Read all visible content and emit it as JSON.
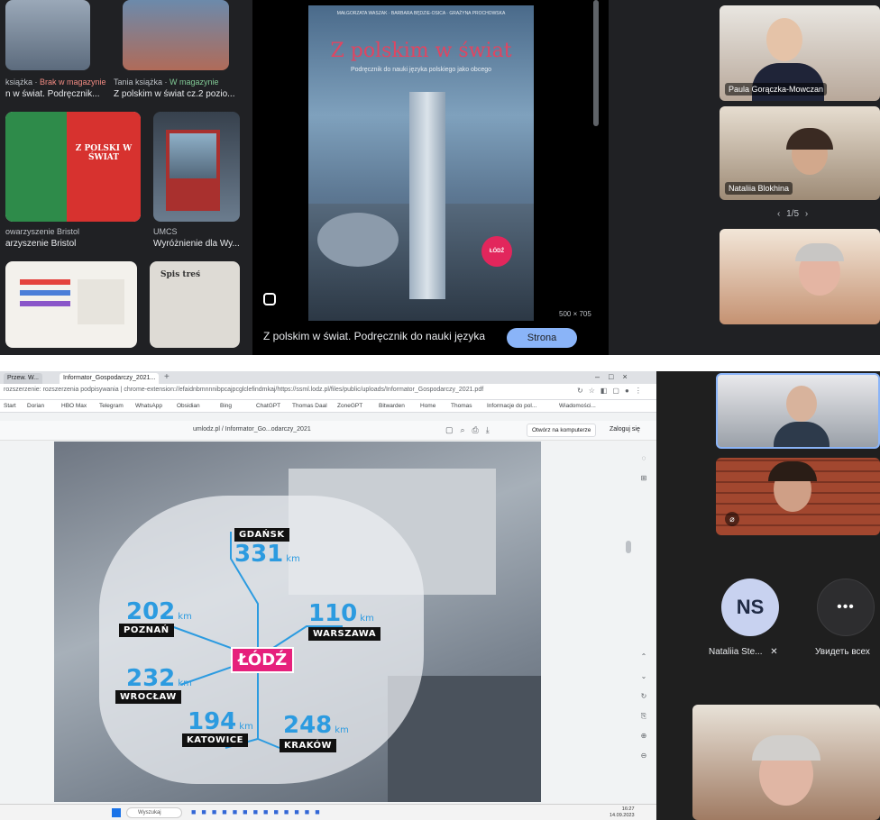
{
  "top": {
    "results": [
      {
        "source_prefix": "książka · ",
        "status": "Brak w magazynie",
        "title": "n w świat. Podręcznik..."
      },
      {
        "source_prefix": "Tania książka · ",
        "status": "W magazynie",
        "title": "Z polskim w świat cz.2 pozio..."
      },
      {
        "source_prefix": "",
        "status": "",
        "title": "arzyszenie Bristol",
        "source_line": "owarzyszenie Bristol"
      },
      {
        "source_prefix": "",
        "status": "",
        "title": "Wyróżnienie dla Wy...",
        "source_line": "UMCS"
      }
    ],
    "book_cover_mini_1": "Z POLSKI W ŚWIAT",
    "spis_label": "Spis treś",
    "viewer": {
      "cover_authors": "MAŁGORZATA WASZAK · BARBARA BĘDZIE-OSICA · GRAŻYNA PROCHOWSKA",
      "cover_title": "Z polskim w świat",
      "cover_subtitle": "Podręcznik do nauki języka polskiego jako obcego",
      "badge": "ŁÓDŹ",
      "size_label": "500 × 705",
      "caption": "Z polskim w świat. Podręcznik do nauki języka",
      "visit_button": "Strona"
    },
    "meeting": {
      "participant_1": "Paula Gorączka-Mowczan",
      "participant_2": "Nataliia Blokhina",
      "pager": "1/5"
    }
  },
  "browser": {
    "tabs": [
      "Przew. W...",
      "Informator_Gospodarczy_2021..."
    ],
    "url": "rozszerzenie: rozszerzenia podpisywania | chrome-extension://efaidnbmnnnibpcajpcglclefindmkaj/https://ssml.lodz.pl/files/public/uploads/Informator_Gospodarczy_2021.pdf",
    "bookmarks": [
      "Start",
      "Dorian",
      "HBO Max",
      "Telegram",
      "WhatsApp",
      "Obsidian",
      "Bing",
      "ChatGPT",
      "Thomas Daal",
      "ZoneGPT",
      "Bitwarden",
      "Home",
      "Thomas",
      "Informacje do pol...",
      "Wiadomości..."
    ],
    "pdf_title": "umlodz.pl / Informator_Go...odarczy_2021",
    "open_button": "Otwórz na komputerze",
    "login": "Zaloguj się",
    "map": {
      "center": "ŁÓDŹ",
      "unit": "km",
      "cities": [
        {
          "name": "GDAŃSK",
          "km": "331"
        },
        {
          "name": "POZNAŃ",
          "km": "202"
        },
        {
          "name": "WARSZAWA",
          "km": "110"
        },
        {
          "name": "WROCŁAW",
          "km": "232"
        },
        {
          "name": "KATOWICE",
          "km": "194"
        },
        {
          "name": "KRAKÓW",
          "km": "248"
        }
      ]
    },
    "taskbar": {
      "search": "Wyszukaj",
      "time": "16:27",
      "date": "14.09.2023"
    }
  },
  "meeting_bottom": {
    "initials": "NS",
    "participant_name": "Nataliia Ste...",
    "more_label": "Увидеть всех"
  }
}
